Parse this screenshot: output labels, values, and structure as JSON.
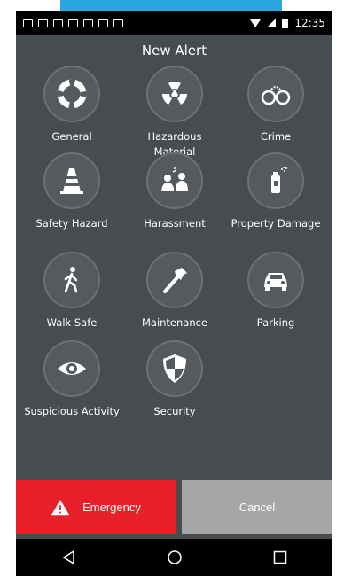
{
  "header": {
    "title": "New Alert"
  },
  "status": {
    "time": "12:35"
  },
  "tiles": [
    {
      "label": "General",
      "icon": "lifebuoy-icon"
    },
    {
      "label": "Hazardous Material",
      "icon": "radiation-icon"
    },
    {
      "label": "Crime",
      "icon": "handcuffs-icon"
    },
    {
      "label": "Safety Hazard",
      "icon": "traffic-cone-icon"
    },
    {
      "label": "Harassment",
      "icon": "harassment-icon"
    },
    {
      "label": "Property Damage",
      "icon": "spray-can-icon"
    },
    {
      "label": "Walk Safe",
      "icon": "walking-person-icon"
    },
    {
      "label": "Maintenance",
      "icon": "hammer-icon"
    },
    {
      "label": "Parking",
      "icon": "car-icon"
    },
    {
      "label": "Suspicious Activity",
      "icon": "eye-icon"
    },
    {
      "label": "Security",
      "icon": "shield-icon"
    }
  ],
  "actions": {
    "emergency_label": "Emergency",
    "cancel_label": "Cancel"
  },
  "colors": {
    "emergency": "#e8202a",
    "cancel": "#a6a6a6",
    "background": "#474c50",
    "accent": "#29a8e0"
  }
}
